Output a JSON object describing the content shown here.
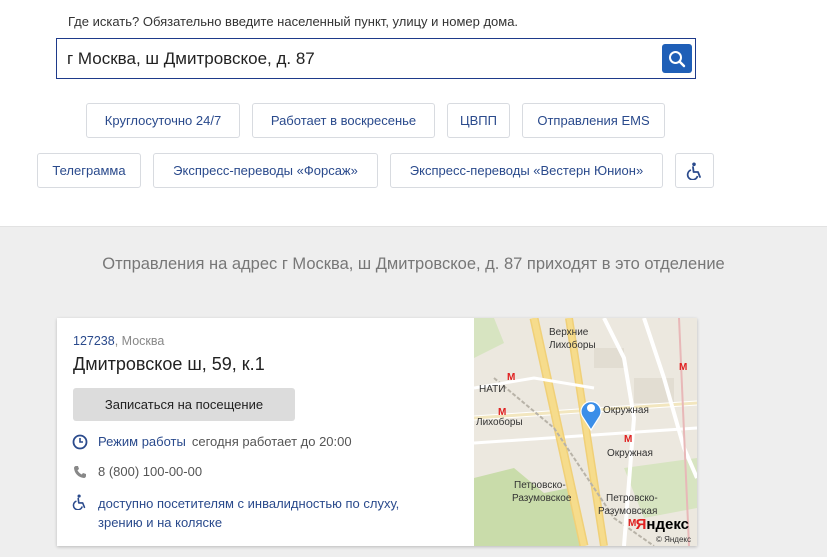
{
  "search": {
    "hint": "Где искать? Обязательно введите населенный пункт, улицу и номер дома.",
    "value": "г Москва, ш Дмитровское, д. 87",
    "button_icon": "search-icon"
  },
  "filters": {
    "row1": [
      "Круглосуточно 24/7",
      "Работает в воскресенье",
      "ЦВПП",
      "Отправления EMS"
    ],
    "row2": [
      "Телеграмма",
      "Экспресс-переводы «Форсаж»",
      "Экспресс-переводы «Вестерн Юнион»"
    ],
    "accessibility_icon": "wheelchair-icon"
  },
  "result": {
    "heading": "Отправления на адрес г Москва, ш Дмитровское, д. 87 приходят в это отделение",
    "office": {
      "zip": "127238",
      "city": ", Москва",
      "address": "Дмитровское ш, 59, к.1",
      "book_label": "Записаться на посещение",
      "hours_label": "Режим работы",
      "hours_value": "сегодня работает до 20:00",
      "phone": "8 (800) 100-00-00",
      "accessibility_line1": "доступно посетителям с инвалидностью по слуху,",
      "accessibility_line2": "зрению и на коляске"
    },
    "map": {
      "labels": {
        "verkhnie": "Верхние",
        "likhobory": "Лихоборы",
        "nati": "НАТИ",
        "likhobory2": "Лихоборы",
        "okruzhnaya": "Окружная",
        "okruzhnaya2": "Окружная",
        "petrovsko_razumovskoe": "Петровско-",
        "petrovsko_razumovskoe2": "Разумовское",
        "petrovsko_right": "Петровско-",
        "razumovskaya_right": "Разумовская"
      },
      "logo_y": "Я",
      "logo_rest": "ндекс",
      "copyright": "© Яндекс"
    }
  },
  "colors": {
    "accent": "#1f5fb7",
    "link": "#2a4a8c",
    "metro": "#e02020",
    "pin": "#3b8ee8"
  }
}
